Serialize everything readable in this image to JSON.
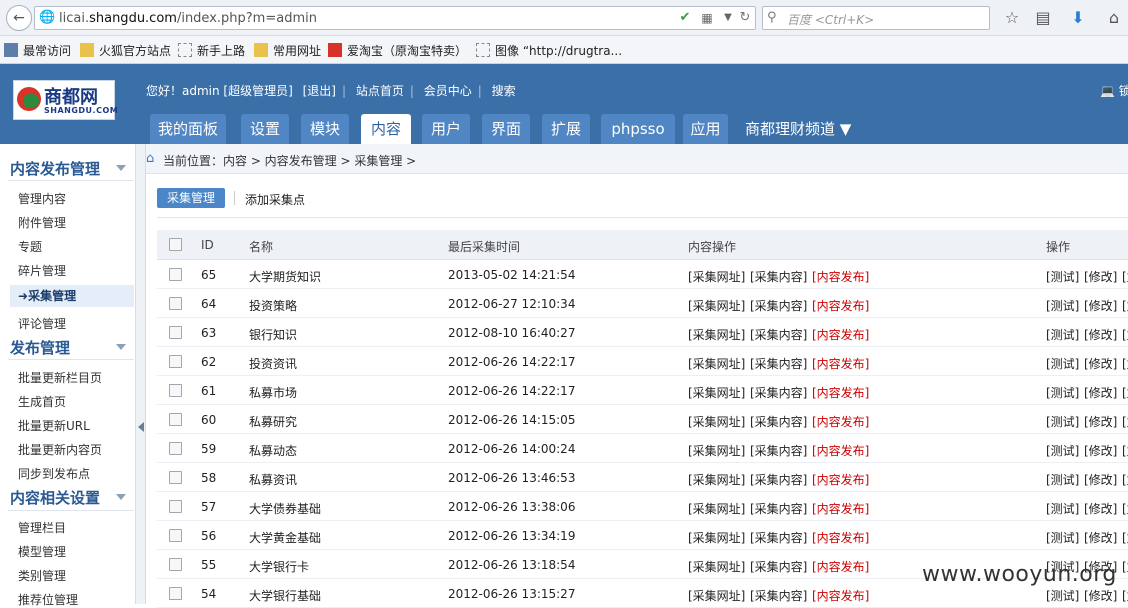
{
  "browser": {
    "url_prefix": "licai.",
    "url_domain": "shangdu.com",
    "url_path": "/index.php?m=admin",
    "search_placeholder": "百度 <Ctrl+K>",
    "bookmarks": [
      "最常访问",
      "火狐官方站点",
      "新手上路",
      "常用网址",
      "爱淘宝（原淘宝特卖）",
      "图像 “http://drugtra..."
    ]
  },
  "header": {
    "logo_cn": "商都网",
    "logo_en": "SHANGDU.COM",
    "greeting": "您好！admin [超级管理员]",
    "links": [
      "[退出]",
      "站点首页",
      "会员中心",
      "搜索"
    ],
    "right_cut": "锁",
    "tabs": [
      "我的面板",
      "设置",
      "模块",
      "内容",
      "用户",
      "界面",
      "扩展",
      "phpsso",
      "应用"
    ],
    "active_tab": "内容",
    "channel": "商都理财频道"
  },
  "sidebar": {
    "groups": [
      {
        "title": "内容发布管理",
        "items": [
          "管理内容",
          "附件管理",
          "专题",
          "碎片管理",
          "采集管理",
          "评论管理"
        ]
      },
      {
        "title": "发布管理",
        "items": [
          "批量更新栏目页",
          "生成首页",
          "批量更新URL",
          "批量更新内容页",
          "同步到发布点"
        ]
      },
      {
        "title": "内容相关设置",
        "items": [
          "管理栏目",
          "模型管理",
          "类别管理",
          "推荐位管理"
        ]
      }
    ],
    "active_item": "采集管理"
  },
  "breadcrumb": "当前位置：内容 > 内容发布管理 > 采集管理 >",
  "subnav": {
    "active": "采集管理",
    "link": "添加采集点"
  },
  "table": {
    "headers": [
      "ID",
      "名称",
      "最后采集时间",
      "内容操作",
      "操作"
    ],
    "rows": [
      {
        "id": "65",
        "name": "大学期货知识",
        "time": "2013-05-02 14:21:54"
      },
      {
        "id": "64",
        "name": "投资策略",
        "time": "2012-06-27 12:10:34"
      },
      {
        "id": "63",
        "name": "银行知识",
        "time": "2012-08-10 16:40:27"
      },
      {
        "id": "62",
        "name": "投资资讯",
        "time": "2012-06-26 14:22:17"
      },
      {
        "id": "61",
        "name": "私募市场",
        "time": "2012-06-26 14:22:17"
      },
      {
        "id": "60",
        "name": "私募研究",
        "time": "2012-06-26 14:15:05"
      },
      {
        "id": "59",
        "name": "私募动态",
        "time": "2012-06-26 14:00:24"
      },
      {
        "id": "58",
        "name": "私募资讯",
        "time": "2012-06-26 13:46:53"
      },
      {
        "id": "57",
        "name": "大学债券基础",
        "time": "2012-06-26 13:38:06"
      },
      {
        "id": "56",
        "name": "大学黄金基础",
        "time": "2012-06-26 13:34:19"
      },
      {
        "id": "55",
        "name": "大学银行卡",
        "time": "2012-06-26 13:18:54"
      },
      {
        "id": "54",
        "name": "大学银行基础",
        "time": "2012-06-26 13:15:27"
      }
    ],
    "content_ops": [
      "[采集网址]",
      "[采集内容]",
      "[内容发布]"
    ],
    "ops": [
      "[测试]",
      "[修改]",
      "[复制]"
    ]
  },
  "watermark": "www.wooyun.org"
}
